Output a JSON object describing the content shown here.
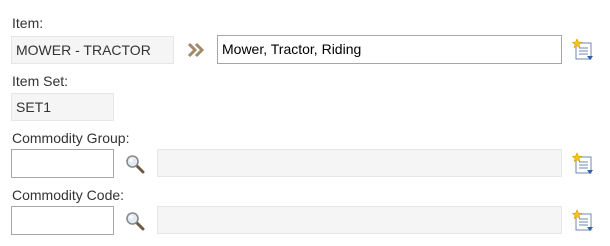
{
  "item": {
    "label": "Item:",
    "code": "MOWER - TRACTOR",
    "description": "Mower, Tractor, Riding",
    "navigate_icon": "double-chevron-right-icon",
    "notes_icon": "notes-icon"
  },
  "item_set": {
    "label": "Item Set:",
    "value": "SET1"
  },
  "commodity_group": {
    "label": "Commodity Group:",
    "value": "",
    "description": "",
    "search_icon": "search-icon",
    "notes_icon": "notes-icon"
  },
  "commodity_code": {
    "label": "Commodity Code:",
    "value": "",
    "description": "",
    "search_icon": "search-icon",
    "notes_icon": "notes-icon"
  },
  "colors": {
    "readonly_bg": "#f5f5f5",
    "input_border": "#a6a6a6",
    "chevron": "#a08a6a"
  }
}
